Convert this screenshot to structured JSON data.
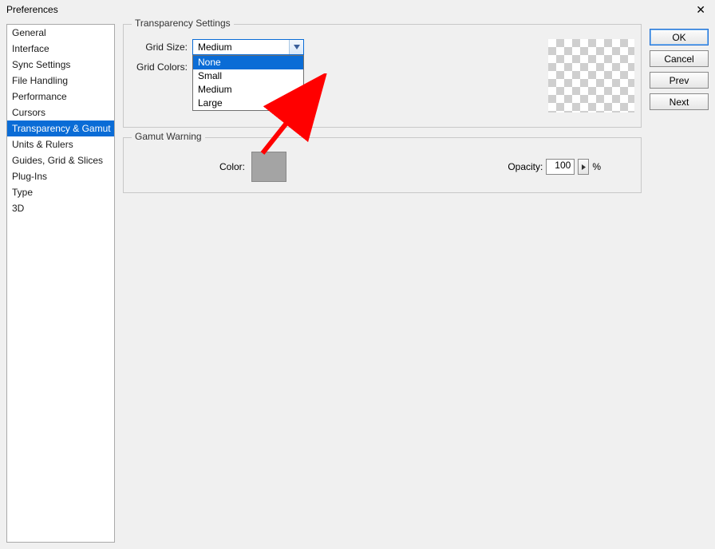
{
  "title": "Preferences",
  "sidebar": {
    "items": [
      {
        "label": "General"
      },
      {
        "label": "Interface"
      },
      {
        "label": "Sync Settings"
      },
      {
        "label": "File Handling"
      },
      {
        "label": "Performance"
      },
      {
        "label": "Cursors"
      },
      {
        "label": "Transparency & Gamut"
      },
      {
        "label": "Units & Rulers"
      },
      {
        "label": "Guides, Grid & Slices"
      },
      {
        "label": "Plug-Ins"
      },
      {
        "label": "Type"
      },
      {
        "label": "3D"
      }
    ],
    "selected_index": 6
  },
  "transparency": {
    "legend": "Transparency Settings",
    "grid_size_label": "Grid Size:",
    "grid_size_value": "Medium",
    "grid_size_options": [
      "None",
      "Small",
      "Medium",
      "Large"
    ],
    "grid_size_highlight_index": 0,
    "grid_colors_label": "Grid Colors:"
  },
  "gamut": {
    "legend": "Gamut Warning",
    "color_label": "Color:",
    "opacity_label": "Opacity:",
    "opacity_value": "100",
    "opacity_unit": "%"
  },
  "buttons": {
    "ok": "OK",
    "cancel": "Cancel",
    "prev": "Prev",
    "next": "Next"
  }
}
